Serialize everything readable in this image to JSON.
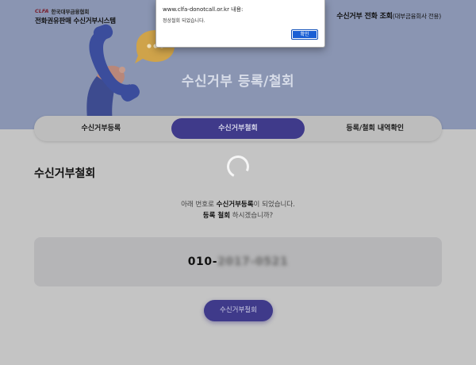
{
  "header": {
    "org_mark": "CLFA",
    "org_name": "한국대부금융협회",
    "system_name": "전화권유판매 수신거부시스템",
    "top_link": "수신거부 전화 조회",
    "top_link_sub": "(대부금융회사 전용)"
  },
  "hero": {
    "title": "수신거부 등록/철회"
  },
  "tabs": [
    {
      "label": "수신거부등록",
      "active": false
    },
    {
      "label": "수신거부철회",
      "active": true
    },
    {
      "label": "등록/철회 내역확인",
      "active": false
    }
  ],
  "section": {
    "title": "수신거부철회"
  },
  "message": {
    "line1_prefix": "아래 번호로 ",
    "line1_bold": "수신거부등록",
    "line1_suffix": "이 되었습니다.",
    "line2_bold": "등록 철회",
    "line2_suffix": " 하시겠습니까?"
  },
  "phone": {
    "prefix": "010-",
    "masked": "2017-0521"
  },
  "submit_label": "수신거부철회",
  "dialog": {
    "title": "www.clfa-donotcall.or.kr 내용:",
    "body": "정상철회 되었습니다.",
    "ok_label": "확인"
  },
  "colors": {
    "accent": "#3f3a8a",
    "hero_bg": "#8a95b2",
    "overlay_bg": "#c4c4c4",
    "dialog_ok": "#1a5fd4"
  },
  "icons": [
    "phone-handset-illustration",
    "chat-bubble-icon",
    "loading-spinner"
  ]
}
